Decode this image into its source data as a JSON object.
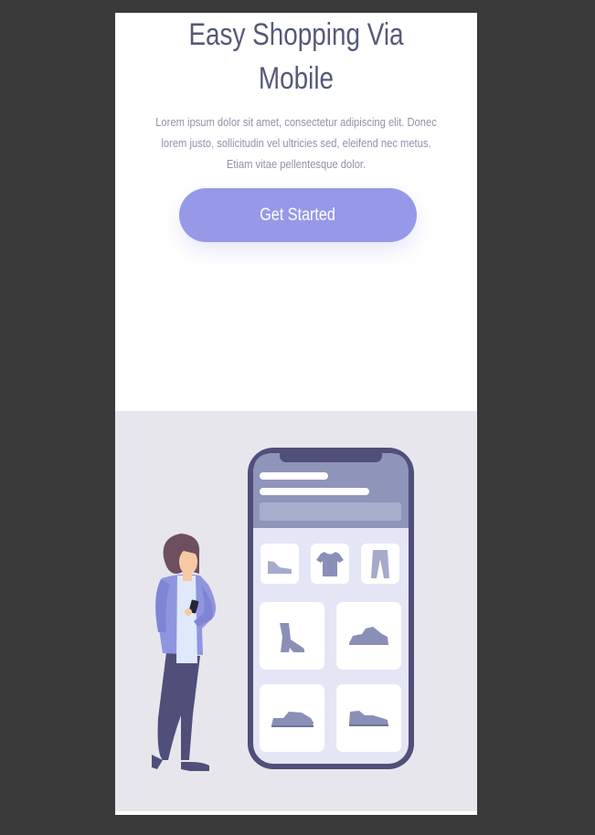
{
  "hero": {
    "title_line1": "Easy Shopping Via",
    "title_line2": "Mobile",
    "text_line1": "Lorem ipsum dolor sit amet, consectetur adipiscing elit. Donec",
    "text_line2": "lorem justo, sollicitudin vel ultricies sed, eleifend nec metus.",
    "text_line3": "Etiam vitae pellentesque dolor.",
    "button_label": "Get Started"
  },
  "colors": {
    "background": "#3a3a3a",
    "page": "#ffffff",
    "heading": "#555a7a",
    "body_text": "#8f93a8",
    "accent": "#9599e8",
    "panel": "#e7e6ec",
    "phone_frame": "#4f4f7a",
    "product": "#8a8fb8"
  },
  "illustration": {
    "phone_products": [
      "shoe-icon",
      "tshirt-icon",
      "pants-icon",
      "boot-icon",
      "sneaker-icon",
      "sneaker-icon",
      "sneaker-icon"
    ]
  }
}
